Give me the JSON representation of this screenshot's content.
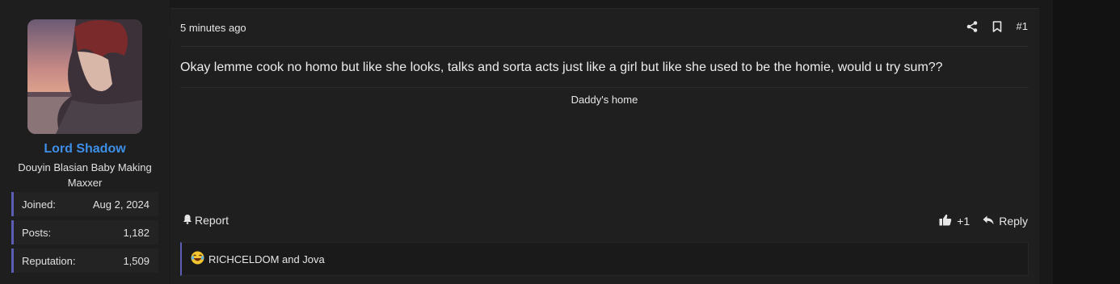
{
  "user": {
    "name": "Lord Shadow",
    "title": "Douyin Blasian Baby Making Maxxer",
    "stats": [
      {
        "label": "Joined:",
        "value": "Aug 2, 2024"
      },
      {
        "label": "Posts:",
        "value": "1,182"
      },
      {
        "label": "Reputation:",
        "value": "1,509"
      }
    ]
  },
  "post": {
    "timestamp": "5 minutes ago",
    "number": "#1",
    "body": "Okay lemme cook no homo but like she looks, talks and sorta acts just like a girl but like she used to be the homie, would u try sum??",
    "signature": "Daddy's home",
    "report_label": "Report",
    "reaction_count": "+1",
    "reply_label": "Reply",
    "reactions_summary": "RICHCELDOM and Jova"
  },
  "icons": {
    "share": "share-icon",
    "bookmark": "bookmark-icon",
    "bell": "bell-icon",
    "like": "thumbs-up-icon",
    "reply": "reply-arrow-icon",
    "reaction": "laughing-emoji-icon"
  },
  "colors": {
    "username": "#3d8fe8",
    "accent_bar": "#5a5fb3"
  }
}
